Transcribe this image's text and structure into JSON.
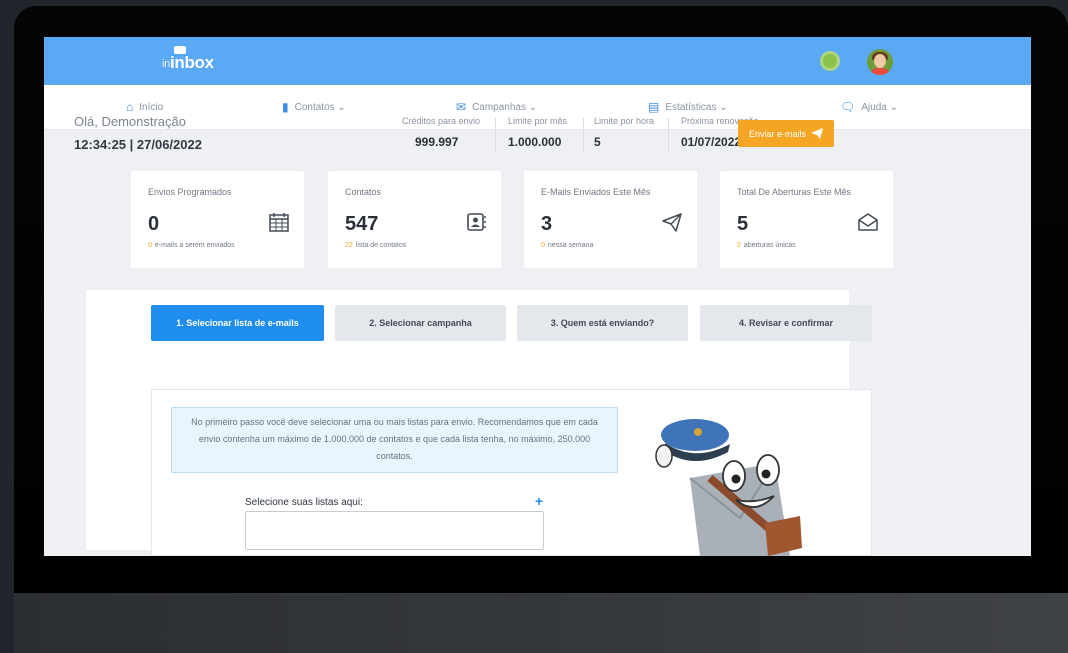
{
  "brand": {
    "logo_text": "inbox",
    "logo_prefix": "in"
  },
  "nav": {
    "items": [
      {
        "label": "Início"
      },
      {
        "label": "Contatos ⌄"
      },
      {
        "label": "Campanhas ⌄"
      },
      {
        "label": "Estatísticas ⌄"
      },
      {
        "label": "Ajuda ⌄"
      }
    ]
  },
  "header": {
    "greeting": "Olá, Demonstração",
    "datetime": "12:34:25 | 27/06/2022",
    "stats": [
      {
        "label": "Créditos para envio",
        "value": "999.997"
      },
      {
        "label": "Limite por mês",
        "value": "1.000.000"
      },
      {
        "label": "Limite por hora",
        "value": "5"
      },
      {
        "label": "Próxima renovação",
        "value": "01/07/2022"
      }
    ],
    "send_button": "Enviar e-mails"
  },
  "cards": [
    {
      "title": "Envios Programados",
      "value": "0",
      "sub_num": "0",
      "sub_text": "e-mails a serem enviados",
      "icon": "calendar-icon"
    },
    {
      "title": "Contatos",
      "value": "547",
      "sub_num": "22",
      "sub_text": "lista de contatos",
      "icon": "contact-book-icon"
    },
    {
      "title": "E-Mails Enviados Este Mês",
      "value": "3",
      "sub_num": "0",
      "sub_text": "nessa semana",
      "icon": "paper-plane-icon"
    },
    {
      "title": "Total De Aberturas Este Mês",
      "value": "5",
      "sub_num": "2",
      "sub_text": "aberturas únicas",
      "icon": "open-envelope-icon"
    }
  ],
  "steps": [
    {
      "label": "1. Selecionar lista de e-mails"
    },
    {
      "label": "2. Selecionar campanha"
    },
    {
      "label": "3. Quem está enviando?"
    },
    {
      "label": "4. Revisar e confirmar"
    }
  ],
  "wizard": {
    "info_text": "No primeiro passo você deve selecionar uma ou mais listas para envio. Recomendamos que em cada envio contenha um máximo de 1.000.000 de contatos e que cada lista tenha, no máximo, 250.000 contatos.",
    "select_label": "Selecione suas listas aqui:",
    "add_symbol": "+"
  },
  "colors": {
    "topbar": "#5ba8f5",
    "accent": "#1f8ded",
    "orange": "#f5a524"
  }
}
